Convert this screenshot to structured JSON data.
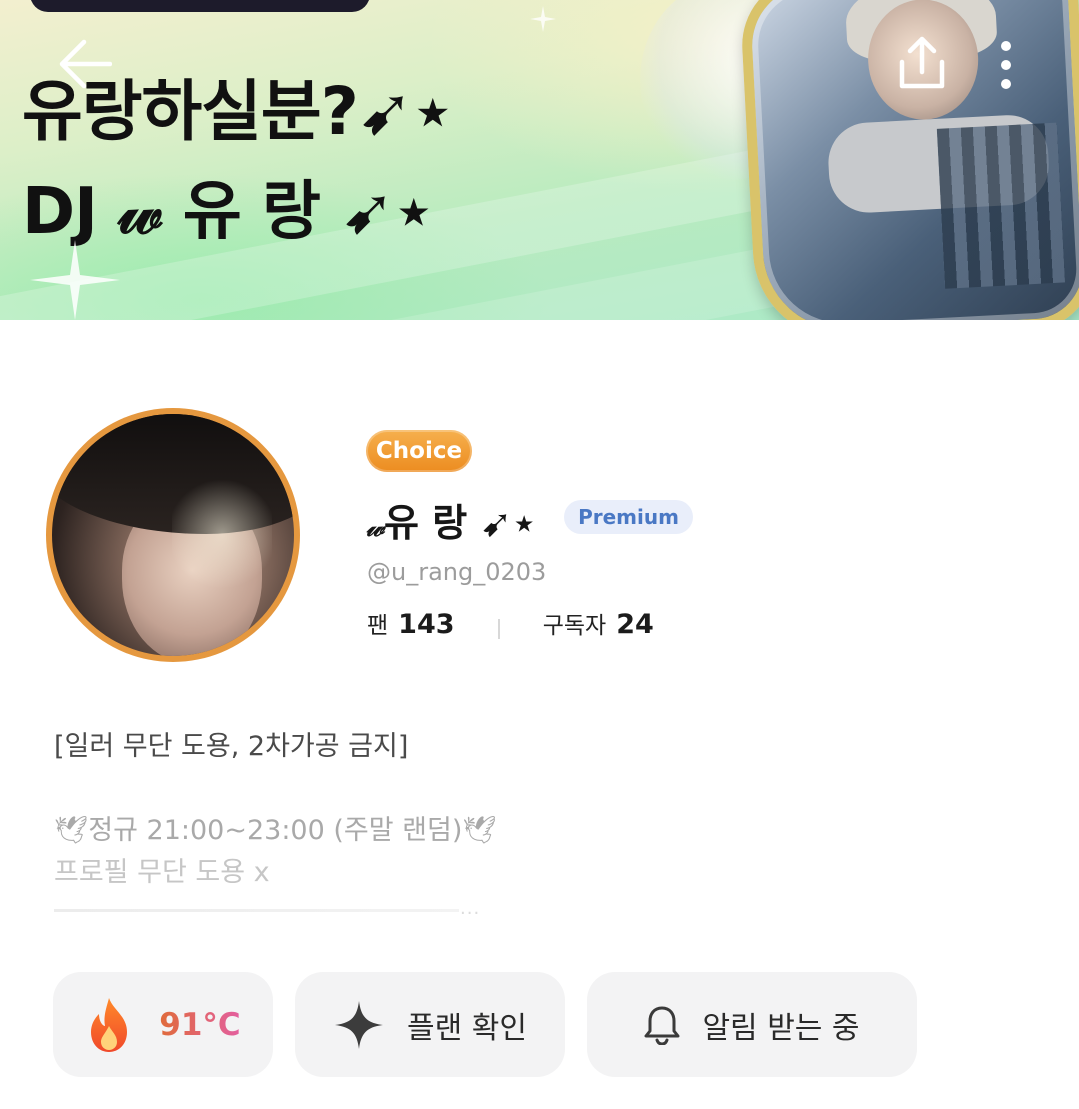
{
  "banner": {
    "title_line1": "유랑하실분?➹⋆",
    "title_line2": "DJ 𝓌 유 랑 ➹⋆"
  },
  "header": {
    "back_icon": "arrow-left-icon",
    "share_icon": "share-icon",
    "more_icon": "more-vertical-icon"
  },
  "profile": {
    "choice_badge": "Choice",
    "name_deco": "𝓌",
    "name": "유 랑 ➹⋆",
    "premium_badge": "Premium",
    "handle": "@u_rang_0203",
    "fans_label": "팬",
    "fans_value": "143",
    "subscribers_label": "구독자",
    "subscribers_value": "24",
    "avatar_ring_color": "#e5983f"
  },
  "bio": {
    "line1": "[일러 무단 도용, 2차가공 금지]",
    "line2": "🕊정규 21:00~23:00 (주말 랜덤)🕊",
    "line3": "프로필 무단 도용 x",
    "more_dots": "..."
  },
  "actions": {
    "temperature": "91°C",
    "plan_label": "플랜 확인",
    "alarm_label": "알림 받는 중"
  },
  "colors": {
    "accent_orange": "#ec8c20",
    "premium_blue": "#4a78c4"
  }
}
